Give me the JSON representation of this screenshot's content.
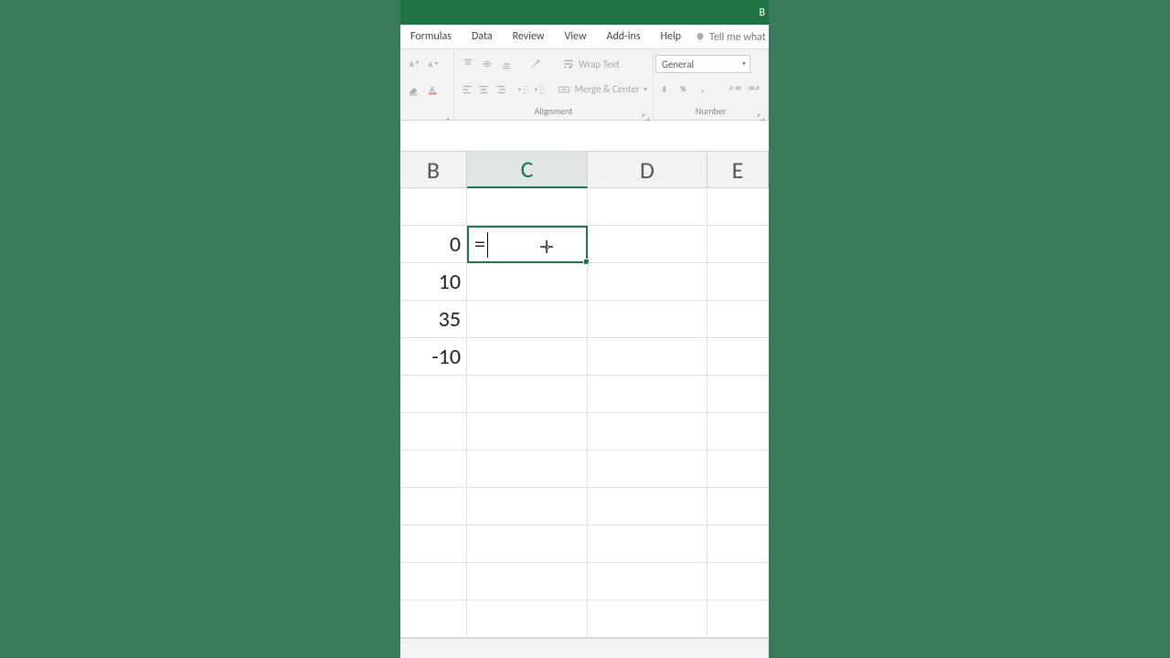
{
  "title_partial": "B",
  "ribbon": {
    "tabs": [
      "Formulas",
      "Data",
      "Review",
      "View",
      "Add-ins",
      "Help"
    ],
    "tellme": "Tell me what you",
    "number_format": "General",
    "wrap_label": "Wrap Text",
    "merge_label": "Merge & Center",
    "group_alignment": "Alignment",
    "group_number": "Number"
  },
  "columns": {
    "B": "B",
    "C": "C",
    "D": "D",
    "E": "E"
  },
  "cells": {
    "B2": "0",
    "B3": "10",
    "B4": "35",
    "B5": "-10",
    "C2_editing": "="
  }
}
